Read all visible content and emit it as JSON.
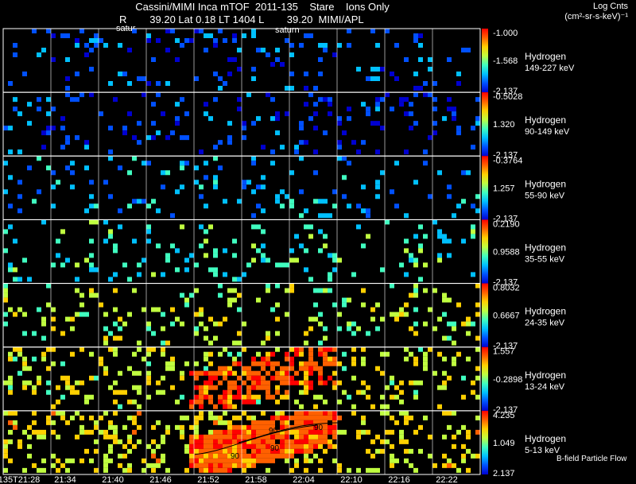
{
  "header": {
    "title": "Cassini/MIMI Inca mTOF  2011-135    Stare    Ions Only",
    "subtitle": "R        39.20 Lat 0.18 LT 1404 L        39.20  MIMI/APL",
    "units_line1": "Log Cnts",
    "units_line2": "(cm²-sr-s-keV)⁻¹",
    "overlay_labels": [
      "satur",
      "saturn"
    ]
  },
  "chart_data": {
    "type": "heatmap",
    "x_ticks": [
      "135T21:28",
      "21:34",
      "21:40",
      "21:46",
      "21:52",
      "21:58",
      "22:04",
      "22:10",
      "22:16",
      "22:22"
    ],
    "colormap": [
      "#0000d0",
      "#0050ff",
      "#00c0ff",
      "#40ffc0",
      "#c0ff40",
      "#ffd000",
      "#ff6000",
      "#ff0000"
    ],
    "grid": true,
    "annotation": "B-field Particle Flow",
    "contour_label": "90",
    "panels": [
      {
        "species": "Hydrogen",
        "energy": "149-227 keV",
        "cb_max": "-1.000",
        "cb_mid": "-1.568",
        "cb_min": "-2.137",
        "intensity": 0.15,
        "density": 0.1
      },
      {
        "species": "Hydrogen",
        "energy": "90-149 keV",
        "cb_max": "-0.5028",
        "cb_mid": "1.320",
        "cb_min": "-2.137",
        "intensity": 0.1,
        "density": 0.12
      },
      {
        "species": "Hydrogen",
        "energy": "55-90 keV",
        "cb_max": "-0.3764",
        "cb_mid": "1.257",
        "cb_min": "-2.137",
        "intensity": 0.25,
        "density": 0.1
      },
      {
        "species": "Hydrogen",
        "energy": "35-55 keV",
        "cb_max": "0.2190",
        "cb_mid": "0.9588",
        "cb_min": "-2.137",
        "intensity": 0.4,
        "density": 0.12
      },
      {
        "species": "Hydrogen",
        "energy": "24-35 keV",
        "cb_max": "0.8032",
        "cb_mid": "0.6667",
        "cb_min": "-2.137",
        "intensity": 0.55,
        "density": 0.14
      },
      {
        "species": "Hydrogen",
        "energy": "13-24 keV",
        "cb_max": "1.557",
        "cb_mid": "-0.2898",
        "cb_min": "-2.137",
        "intensity": 0.62,
        "density": 0.2
      },
      {
        "species": "Hydrogen",
        "energy": "5-13 keV",
        "cb_max": "4.235",
        "cb_mid": "1.049",
        "cb_min": "2.137",
        "intensity": 0.65,
        "density": 0.25
      }
    ]
  }
}
